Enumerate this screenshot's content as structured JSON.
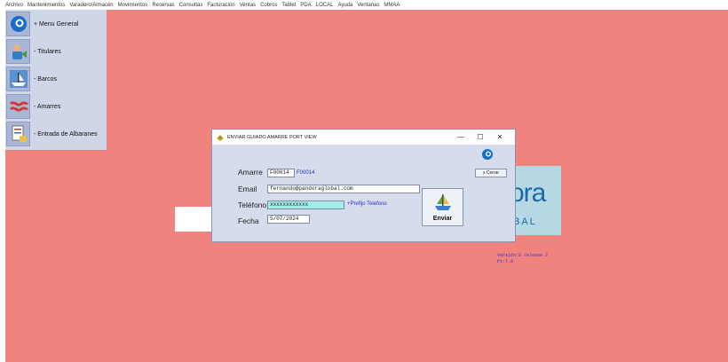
{
  "menu": [
    "Archivo",
    "Mantenimientos",
    "Varadero/Almacén",
    "Movimientos",
    "Reservas",
    "Consultas",
    "Facturación",
    "Ventas",
    "Cobros",
    "Tablet",
    "PDA",
    "LOCAL",
    "Ayuda",
    "Ventanas",
    "MMAA"
  ],
  "sidebar": {
    "items": [
      {
        "label": "+ Menu General",
        "icon": "pandora-logo-icon"
      },
      {
        "label": "- Titulares",
        "icon": "owner-icon"
      },
      {
        "label": "- Barcos",
        "icon": "boat-icon"
      },
      {
        "label": "- Amarres",
        "icon": "mooring-icon"
      },
      {
        "label": "- Entrada de Albaranes",
        "icon": "delivery-note-icon"
      }
    ]
  },
  "background": {
    "logo_big": "ora",
    "logo_small": "BAL",
    "version_line1": "Versión:8 release 2",
    "version_line2": "Pt:7.0"
  },
  "dialog": {
    "title": "ENVIAR GUIADO AMARRE PORT VIEW",
    "minimize": "—",
    "maximize": "☐",
    "close": "✕",
    "amarre_label": "Amarre",
    "amarre_value": "F00014",
    "amarre_desc": "F00014",
    "email_label": "Email",
    "email_value": "fernando@pandoraglobal.com",
    "telefono_label": "Teléfono",
    "telefono_value": "xxxxxxxxxxxx",
    "prefijo_label": "+Prefijo Telefono",
    "fecha_label": "Fecha",
    "fecha_value": "5/07/2024",
    "cerrar_label": "x Cerrar",
    "enviar_label": "Enviar"
  },
  "colors": {
    "desktop": "#f0837e",
    "panel": "#cfd6e8",
    "dialog": "#d5dcec",
    "accent": "#2535c0"
  }
}
